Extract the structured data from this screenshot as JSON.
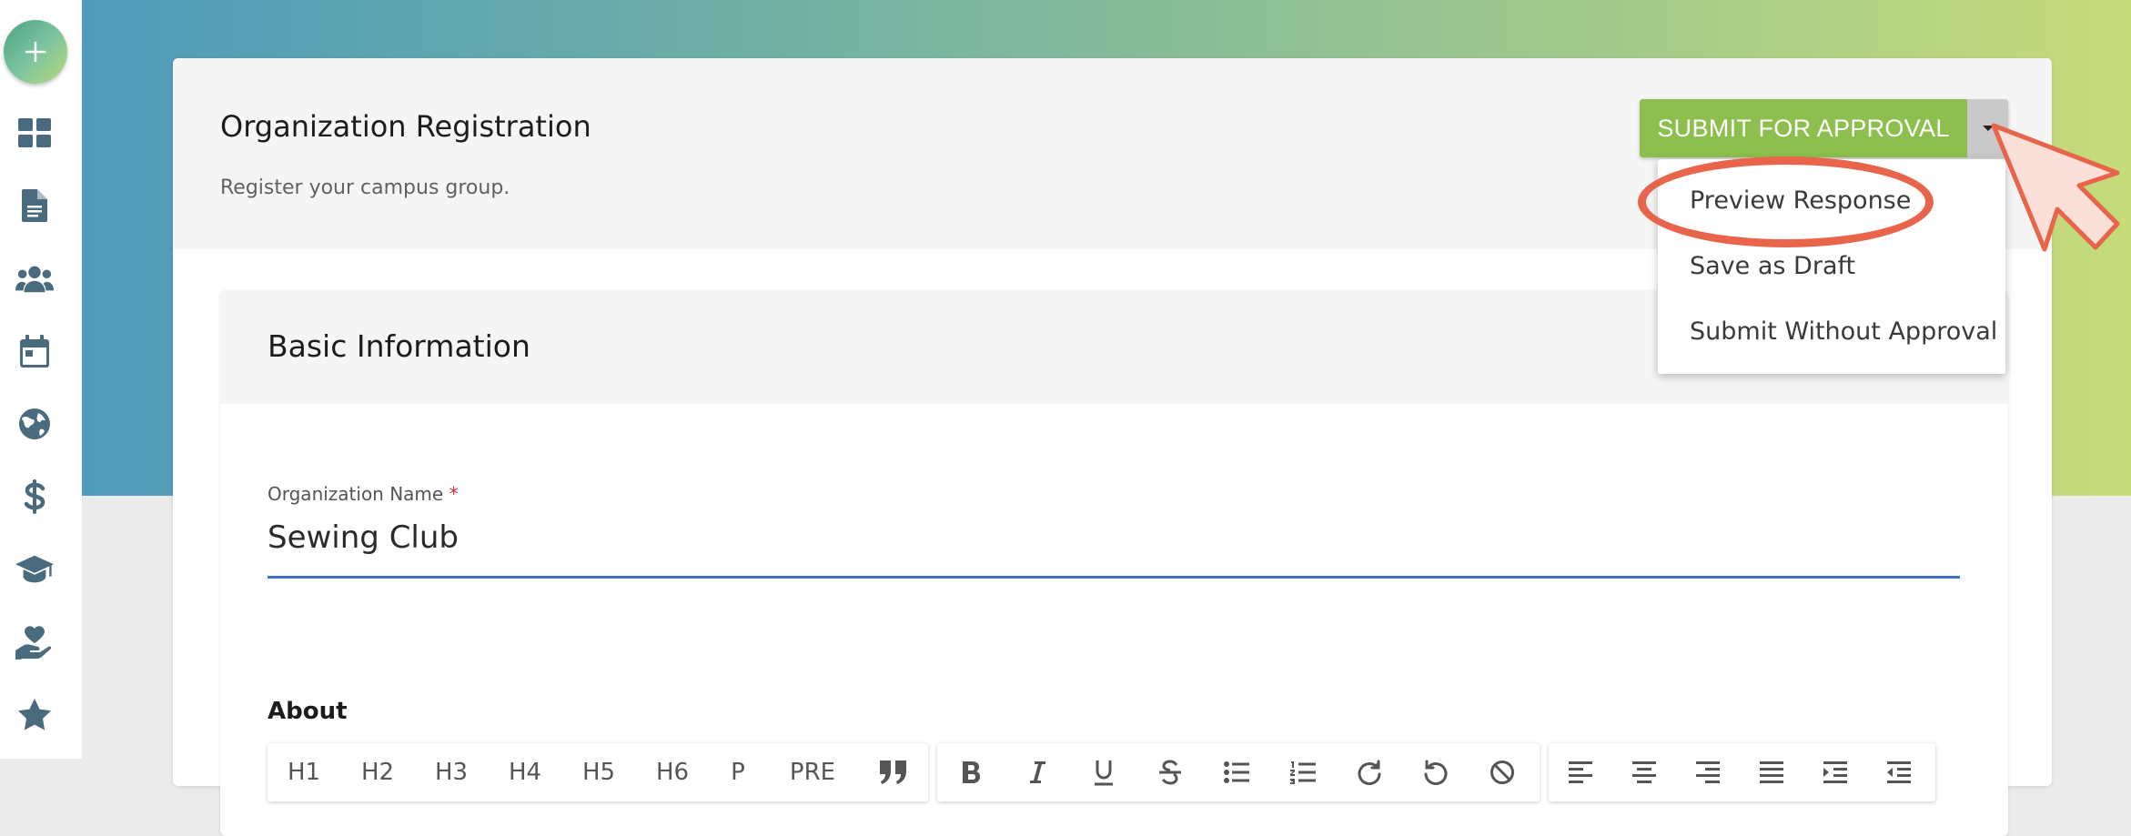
{
  "sidebar": {
    "add_icon": "plus-icon",
    "items": [
      {
        "icon": "dashboard-icon"
      },
      {
        "icon": "document-icon"
      },
      {
        "icon": "users-icon"
      },
      {
        "icon": "calendar-icon"
      },
      {
        "icon": "globe-icon"
      },
      {
        "icon": "dollar-icon"
      },
      {
        "icon": "graduation-cap-icon"
      },
      {
        "icon": "hand-heart-icon"
      },
      {
        "icon": "star-icon"
      }
    ]
  },
  "header": {
    "title": "Organization Registration",
    "subtitle": "Register your campus group."
  },
  "submit": {
    "label": "SUBMIT FOR APPROVAL",
    "caret_icon": "caret-down-icon"
  },
  "dropdown": {
    "items": [
      "Preview Response",
      "Save as Draft",
      "Submit Without Approval"
    ]
  },
  "section": {
    "title": "Basic Information",
    "org_name": {
      "label": "Organization Name",
      "required_mark": "*",
      "value": "Sewing Club"
    },
    "about_label": "About"
  },
  "editor_toolbar": {
    "headings": [
      "H1",
      "H2",
      "H3",
      "H4",
      "H5",
      "H6",
      "P",
      "PRE"
    ],
    "group1_icons": [
      "blockquote-icon"
    ],
    "group2_icons": [
      "bold-icon",
      "italic-icon",
      "underline-icon",
      "strikethrough-icon",
      "bullet-list-icon",
      "numbered-list-icon",
      "redo-icon",
      "undo-icon",
      "clear-format-icon"
    ],
    "group3_icons": [
      "align-left-icon",
      "align-center-icon",
      "align-right-icon",
      "align-justify-icon",
      "indent-icon",
      "outdent-icon"
    ]
  },
  "colors": {
    "accent_green": "#8cbf4e",
    "input_underline": "#3a6fc4",
    "annotation": "#e8644a",
    "sidebar_icon": "#4a6a7d"
  }
}
